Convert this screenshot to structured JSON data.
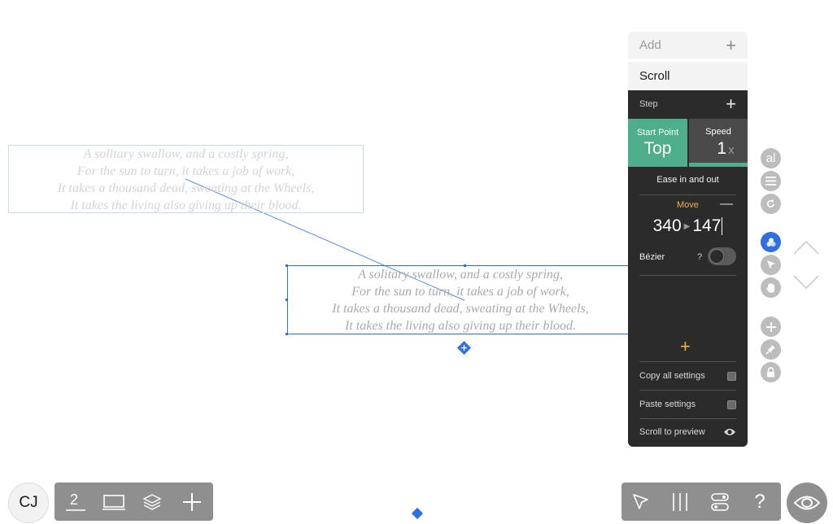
{
  "canvas": {
    "poem_lines": [
      "A solitary swallow, and a costly spring,",
      "For the sun to turn, it takes a job of work,",
      "It takes a thousand dead, sweating at the Wheels,",
      "It takes the living also giving up their blood."
    ]
  },
  "side_menu": {
    "add_label": "Add",
    "add_icon": "+",
    "scroll_label": "Scroll",
    "step_label": "Step",
    "step_add_icon": "+",
    "start_point": {
      "label": "Start Point",
      "value": "Top"
    },
    "speed": {
      "label": "Speed",
      "value": "1",
      "unit": "x"
    },
    "ease_label": "Ease in and out",
    "move": {
      "label": "Move",
      "remove_icon": "—",
      "from": "340",
      "to": "147"
    },
    "bezier": {
      "label": "Bézier",
      "help": "?",
      "enabled": false
    },
    "add_plus": "+",
    "copy_all": "Copy all settings",
    "paste": "Paste settings",
    "scroll_to_preview": "Scroll to preview"
  },
  "tool_buttons": [
    "text-style-icon",
    "align-icon",
    "redo-icon",
    "colors-icon",
    "select-arrow-icon",
    "hand-icon",
    "add-point-icon",
    "pin-icon",
    "lock-icon"
  ],
  "tool_text": {
    "text_style": "al"
  },
  "bottom_left": {
    "avatar": "CJ",
    "page_number": "2",
    "items": [
      "page-number-icon",
      "device-icon",
      "layers-icon",
      "add-icon"
    ]
  },
  "bottom_right": {
    "help": "?",
    "items": [
      "pen-icon",
      "guides-icon",
      "toggles-icon",
      "help-icon",
      "preview-eye-icon"
    ]
  },
  "colors": {
    "accent_green": "#4fae8b",
    "selection_blue": "#2f6fe0",
    "move_orange": "#f0b040",
    "panel_dark": "#2b2b2b"
  }
}
